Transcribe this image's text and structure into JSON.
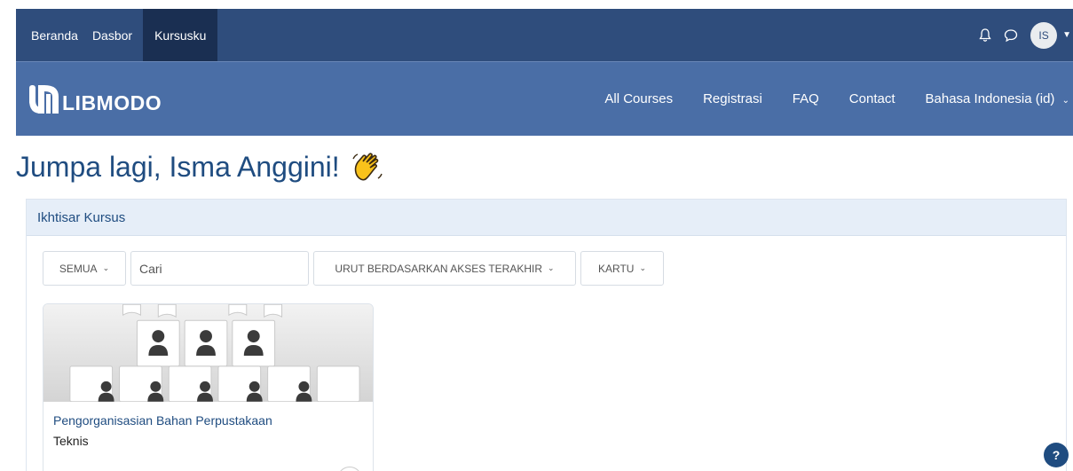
{
  "topnav": {
    "items": [
      {
        "label": "Beranda"
      },
      {
        "label": "Dasbor"
      },
      {
        "label": "Kursusku"
      }
    ],
    "avatar_initials": "IS"
  },
  "brand": {
    "logo_text": "LIBMODO",
    "links": [
      {
        "label": "All Courses"
      },
      {
        "label": "Registrasi"
      },
      {
        "label": "FAQ"
      },
      {
        "label": "Contact"
      },
      {
        "label": "Bahasa Indonesia (id)"
      }
    ]
  },
  "greeting": "Jumpa lagi, Isma Anggini!",
  "overview": {
    "title": "Ikhtisar Kursus",
    "filter_all": "SEMUA",
    "search_placeholder": "Cari",
    "sort_label": "URUT BERDASARKAN AKSES TERAKHIR",
    "view_label": "KARTU",
    "courses": [
      {
        "title": "Pengorganisasian Bahan Perpustakaan",
        "category": "Teknis"
      }
    ]
  },
  "help_label": "?",
  "colors": {
    "topnav_bg": "#2f4d7c",
    "active_bg": "#1a2f52",
    "brand_bg": "#4a6ea6",
    "accent": "#1f4c80",
    "header_bg": "#e6eef8"
  }
}
